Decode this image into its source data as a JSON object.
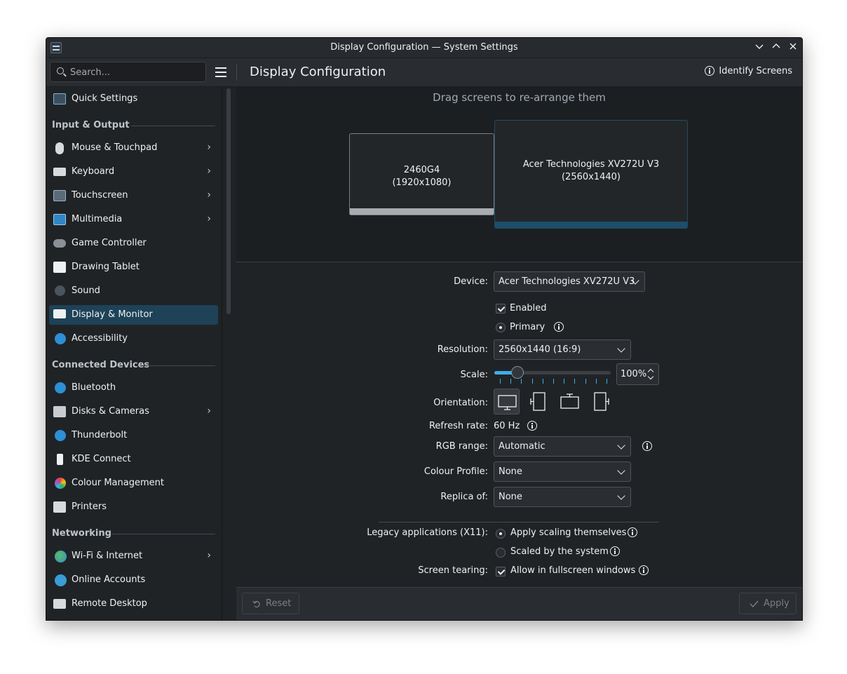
{
  "window": {
    "title": "Display Configuration — System Settings"
  },
  "toolbar": {
    "search_placeholder": "Search...",
    "page_title": "Display Configuration",
    "identify_label": "Identify Screens"
  },
  "sidebar": {
    "quick_settings": "Quick Settings",
    "sections": {
      "input_output": "Input & Output",
      "connected_devices": "Connected Devices",
      "networking": "Networking"
    },
    "items": [
      {
        "label": "Quick Settings"
      },
      {
        "label": "Mouse & Touchpad"
      },
      {
        "label": "Keyboard"
      },
      {
        "label": "Touchscreen"
      },
      {
        "label": "Multimedia"
      },
      {
        "label": "Game Controller"
      },
      {
        "label": "Drawing Tablet"
      },
      {
        "label": "Sound"
      },
      {
        "label": "Display & Monitor"
      },
      {
        "label": "Accessibility"
      },
      {
        "label": "Bluetooth"
      },
      {
        "label": "Disks & Cameras"
      },
      {
        "label": "Thunderbolt"
      },
      {
        "label": "KDE Connect"
      },
      {
        "label": "Colour Management"
      },
      {
        "label": "Printers"
      },
      {
        "label": "Wi-Fi & Internet"
      },
      {
        "label": "Online Accounts"
      },
      {
        "label": "Remote Desktop"
      }
    ]
  },
  "canvas": {
    "hint": "Drag screens to re-arrange them",
    "screens": [
      {
        "name": "2460G4",
        "res": "(1920x1080)"
      },
      {
        "name": "Acer Technologies XV272U V3",
        "res": "(2560x1440)"
      }
    ]
  },
  "form": {
    "device_label": "Device:",
    "device_value": "Acer Technologies XV272U V3",
    "enabled_label": "Enabled",
    "primary_label": "Primary",
    "resolution_label": "Resolution:",
    "resolution_value": "2560x1440 (16:9)",
    "scale_label": "Scale:",
    "scale_value": "100%",
    "scale_fraction": 0.2,
    "orientation_label": "Orientation:",
    "refresh_label": "Refresh rate:",
    "refresh_value": "60 Hz",
    "rgb_label": "RGB range:",
    "rgb_value": "Automatic",
    "colour_label": "Colour Profile:",
    "colour_value": "None",
    "replica_label": "Replica of:",
    "replica_value": "None",
    "legacy_label": "Legacy applications (X11):",
    "legacy_opt1": "Apply scaling themselves",
    "legacy_opt2": "Scaled by the system",
    "tearing_label": "Screen tearing:",
    "tearing_opt": "Allow in fullscreen windows"
  },
  "footer": {
    "reset_label": "Reset",
    "apply_label": "Apply"
  },
  "colors": {
    "accent": "#3daee9",
    "selection": "#1e4258",
    "window_bg": "#202326"
  }
}
